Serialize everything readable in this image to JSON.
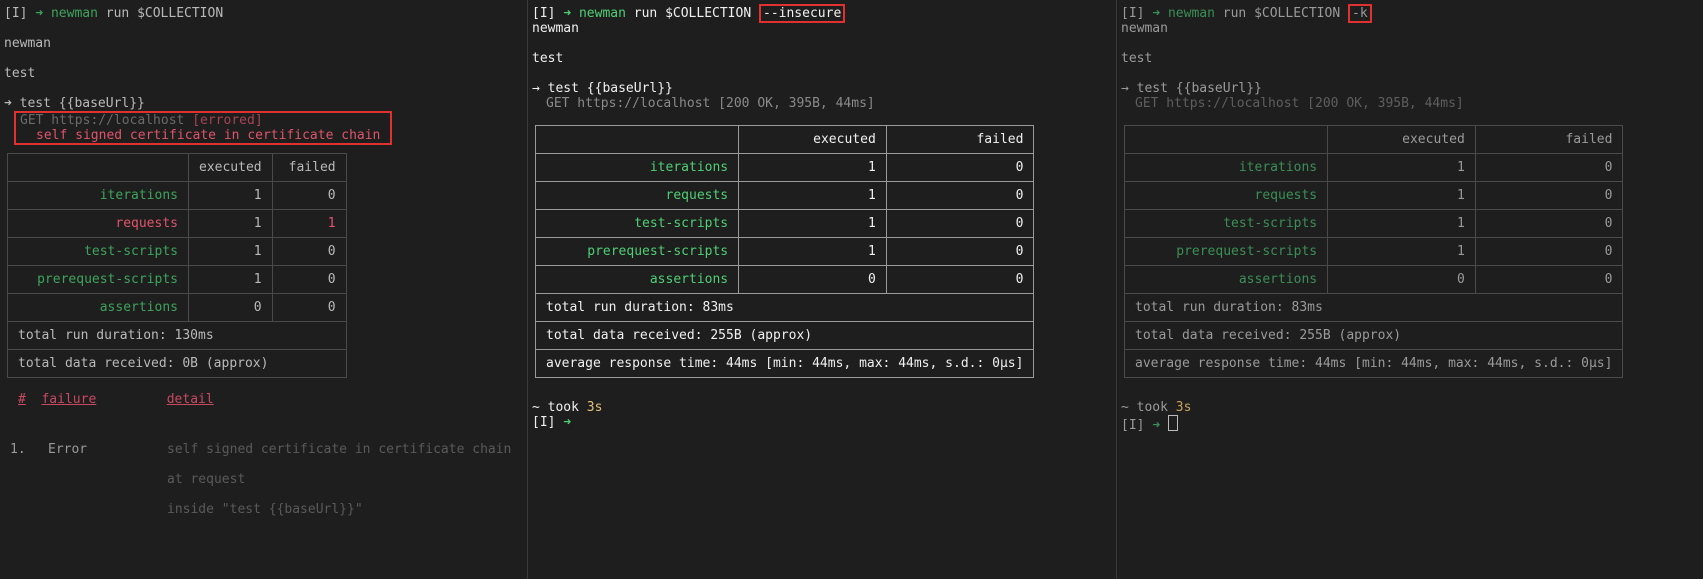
{
  "panes": [
    {
      "prompt": "[I]",
      "arrow": "➜",
      "cmd": "newman",
      "args": "run $COLLECTION",
      "flag": "",
      "collection": "newman",
      "folder": "test",
      "request_arrow": "➜",
      "request_name": "test {{baseUrl}}",
      "request_line": "GET https://localhost",
      "request_status": "[errored]",
      "error_msg": "self signed certificate in certificate chain",
      "table": {
        "header": [
          "",
          "executed",
          "failed"
        ],
        "rows": [
          {
            "label": "iterations",
            "executed": "1",
            "failed": "0"
          },
          {
            "label": "requests",
            "executed": "1",
            "failed": "1"
          },
          {
            "label": "test-scripts",
            "executed": "1",
            "failed": "0"
          },
          {
            "label": "prerequest-scripts",
            "executed": "1",
            "failed": "0"
          },
          {
            "label": "assertions",
            "executed": "0",
            "failed": "0"
          }
        ],
        "footer": [
          "total run duration: 130ms",
          "total data received: 0B (approx)"
        ]
      },
      "failures": {
        "header_num": "#",
        "header_failure": "failure",
        "header_detail": "detail",
        "items": [
          {
            "num": "1.",
            "type": "Error",
            "detail": [
              "self signed certificate in certificate chain",
              "at request",
              "inside \"test {{baseUrl}}\""
            ]
          }
        ]
      }
    },
    {
      "prompt": "[I]",
      "arrow": "➜",
      "cmd": "newman",
      "args": "run $COLLECTION",
      "flag": "--insecure",
      "collection": "newman",
      "folder": "test",
      "request_arrow": "→",
      "request_name": "test {{baseUrl}}",
      "request_line": "GET https://localhost [200 OK, 395B, 44ms]",
      "table": {
        "header": [
          "",
          "executed",
          "failed"
        ],
        "rows": [
          {
            "label": "iterations",
            "executed": "1",
            "failed": "0"
          },
          {
            "label": "requests",
            "executed": "1",
            "failed": "0"
          },
          {
            "label": "test-scripts",
            "executed": "1",
            "failed": "0"
          },
          {
            "label": "prerequest-scripts",
            "executed": "1",
            "failed": "0"
          },
          {
            "label": "assertions",
            "executed": "0",
            "failed": "0"
          }
        ],
        "footer": [
          "total run duration: 83ms",
          "total data received: 255B (approx)",
          "average response time: 44ms [min: 44ms, max: 44ms, s.d.: 0µs]"
        ]
      },
      "took_prefix": "~ took",
      "took_value": "3s",
      "end_prompt": "[I]",
      "end_arrow": "➜"
    },
    {
      "prompt": "[I]",
      "arrow": "➜",
      "cmd": "newman",
      "args": "run $COLLECTION",
      "flag": "-k",
      "collection": "newman",
      "folder": "test",
      "request_arrow": "→",
      "request_name": "test {{baseUrl}}",
      "request_line": "GET https://localhost [200 OK, 395B, 44ms]",
      "table": {
        "header": [
          "",
          "executed",
          "failed"
        ],
        "rows": [
          {
            "label": "iterations",
            "executed": "1",
            "failed": "0"
          },
          {
            "label": "requests",
            "executed": "1",
            "failed": "0"
          },
          {
            "label": "test-scripts",
            "executed": "1",
            "failed": "0"
          },
          {
            "label": "prerequest-scripts",
            "executed": "1",
            "failed": "0"
          },
          {
            "label": "assertions",
            "executed": "0",
            "failed": "0"
          }
        ],
        "footer": [
          "total run duration: 83ms",
          "total data received: 255B (approx)",
          "average response time: 44ms [min: 44ms, max: 44ms, s.d.: 0µs]"
        ]
      },
      "took_prefix": "~ took",
      "took_value": "3s",
      "end_prompt": "[I]",
      "end_arrow": "➜"
    }
  ],
  "colors": {
    "background": "#1e1e1e",
    "prompt_green": "#4fcf74",
    "error_red": "#e0546a",
    "highlight_box": "#e03030",
    "took_yellow": "#e5c07b"
  }
}
